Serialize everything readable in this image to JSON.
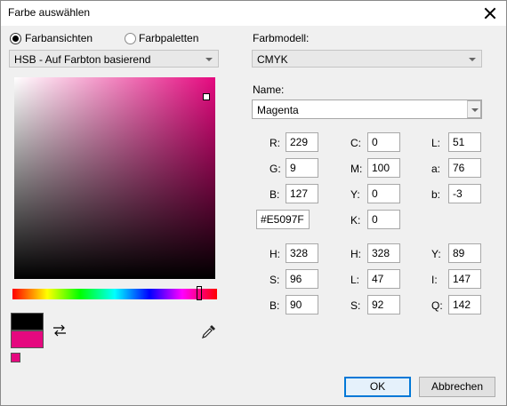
{
  "window": {
    "title": "Farbe auswählen"
  },
  "views": {
    "radio_color_views": "Farbansichten",
    "radio_palettes": "Farbpaletten",
    "mode_select": "HSB - Auf Farbton basierend"
  },
  "model": {
    "label": "Farbmodell:",
    "select": "CMYK",
    "name_label": "Name:",
    "name_value": "Magenta"
  },
  "rgb": {
    "r_label": "R:",
    "r": "229",
    "g_label": "G:",
    "g": "9",
    "b_label": "B:",
    "b": "127",
    "hex": "#E5097F"
  },
  "cmyk": {
    "c_label": "C:",
    "c": "0",
    "m_label": "M:",
    "m": "100",
    "y_label": "Y:",
    "y": "0",
    "k_label": "K:",
    "k": "0"
  },
  "lab": {
    "l_label": "L:",
    "l": "51",
    "a_label": "a:",
    "a": "76",
    "b_label": "b:",
    "b": "-3"
  },
  "hsb": {
    "h_label": "H:",
    "h": "328",
    "s_label": "S:",
    "s": "96",
    "b_label": "B:",
    "b": "90"
  },
  "hls": {
    "h_label": "H:",
    "h": "328",
    "l_label": "L:",
    "l": "47",
    "s_label": "S:",
    "s": "92"
  },
  "yiq": {
    "y_label": "Y:",
    "y": "89",
    "i_label": "I:",
    "i": "147",
    "q_label": "Q:",
    "q": "142"
  },
  "buttons": {
    "ok": "OK",
    "cancel": "Abbrechen"
  },
  "colors": {
    "current": "#e5097f",
    "previous": "#000000",
    "accent": "#0078d7"
  },
  "icons": {
    "swap": "swap-arrows-icon",
    "eyedropper": "eyedropper-icon",
    "close": "close-icon"
  }
}
